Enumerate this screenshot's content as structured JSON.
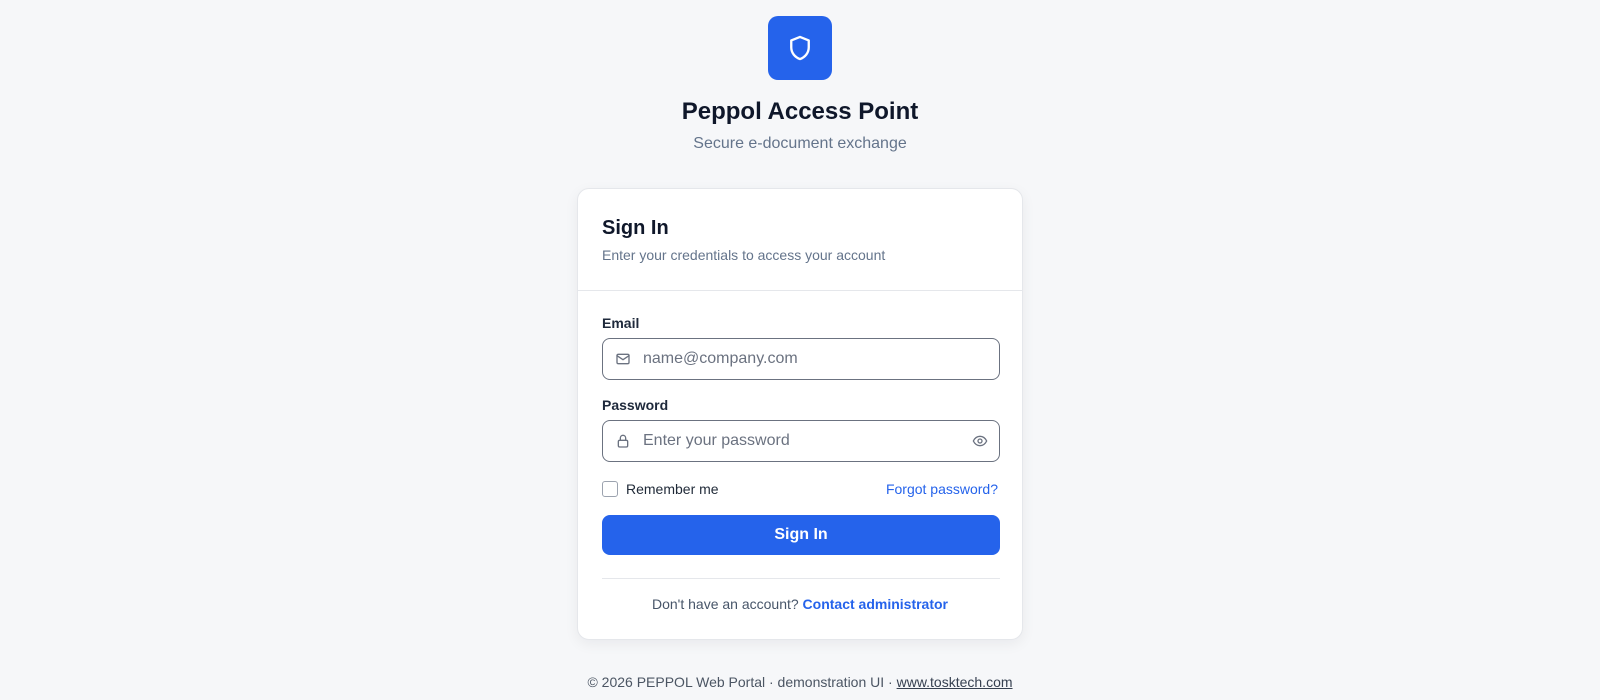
{
  "brand": {
    "title": "Peppol Access Point",
    "subtitle": "Secure e-document exchange",
    "logo_icon": "shield-icon",
    "accent_color": "#2563eb"
  },
  "card": {
    "title": "Sign In",
    "subtitle": "Enter your credentials to access your account",
    "email": {
      "label": "Email",
      "placeholder": "name@company.com",
      "value": "",
      "icon": "mail-icon"
    },
    "password": {
      "label": "Password",
      "placeholder": "Enter your password",
      "value": "",
      "icon": "lock-icon",
      "toggle_icon": "eye-icon"
    },
    "remember_label": "Remember me",
    "remember_checked": false,
    "forgot_label": "Forgot password?",
    "submit_label": "Sign In",
    "signup_prompt": "Don't have an account?",
    "signup_link": "Contact administrator"
  },
  "footer": {
    "text": "© 2026 PEPPOL Web Portal · demonstration UI · ",
    "link": "www.tosktech.com"
  }
}
